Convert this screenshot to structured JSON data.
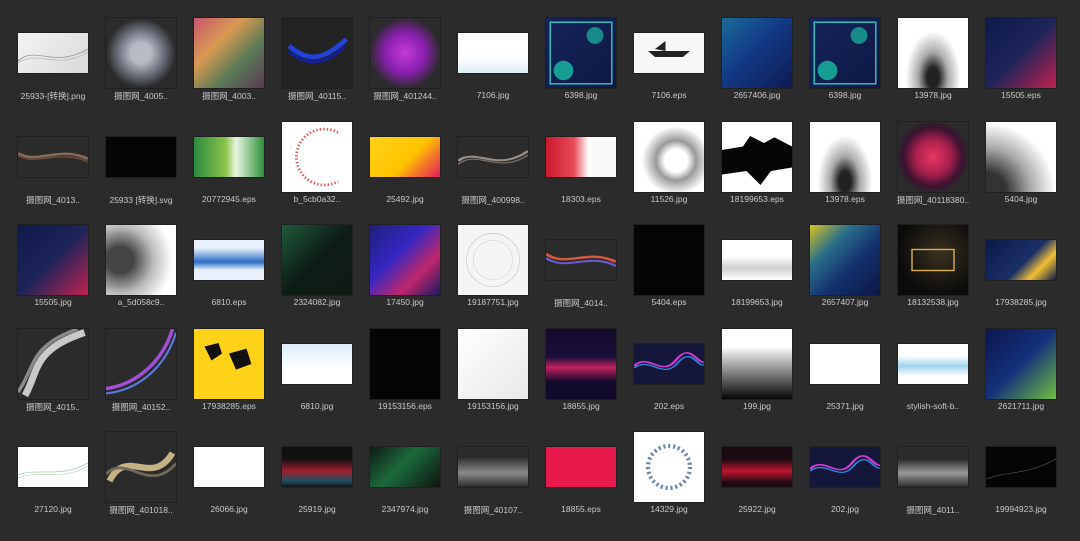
{
  "files": [
    {
      "name": "25933-[转换].png",
      "thumb": "wave-light",
      "shape": "wide"
    },
    {
      "name": "摄图网_4005..",
      "thumb": "halftone-dark",
      "shape": "square"
    },
    {
      "name": "摄图网_4003..",
      "thumb": "checker-colorful",
      "shape": "square"
    },
    {
      "name": "摄图网_40115..",
      "thumb": "blue-swirl-dark",
      "shape": "square"
    },
    {
      "name": "摄图网_401244..",
      "thumb": "purple-glow",
      "shape": "square"
    },
    {
      "name": "7106.jpg",
      "thumb": "white-card",
      "shape": "wide"
    },
    {
      "name": "6398.jpg",
      "thumb": "sample-text-navy",
      "shape": "square"
    },
    {
      "name": "7106.eps",
      "thumb": "white-boat",
      "shape": "wide"
    },
    {
      "name": "2657406.jpg",
      "thumb": "navy-gradient",
      "shape": "square"
    },
    {
      "name": "6398.jpg",
      "thumb": "sample-text-navy",
      "shape": "square"
    },
    {
      "name": "13978.jpg",
      "thumb": "halftone-white",
      "shape": "square"
    },
    {
      "name": "15505.eps",
      "thumb": "navy-pink-dots",
      "shape": "square"
    },
    {
      "name": "摄图网_4013..",
      "thumb": "brown-wave-dark",
      "shape": "wide"
    },
    {
      "name": "25933 [转换].svg",
      "thumb": "black",
      "shape": "wide"
    },
    {
      "name": "20772945.eps",
      "thumb": "green-watercolor",
      "shape": "wide"
    },
    {
      "name": "b_5cb0a32..",
      "thumb": "red-dot-arc",
      "shape": "square"
    },
    {
      "name": "25492.jpg",
      "thumb": "yellow-card",
      "shape": "wide"
    },
    {
      "name": "摄图网_400998..",
      "thumb": "gray-wave-dark",
      "shape": "wide"
    },
    {
      "name": "18303.eps",
      "thumb": "red-white-card",
      "shape": "wide"
    },
    {
      "name": "11526.jpg",
      "thumb": "halftone-circle-white",
      "shape": "square"
    },
    {
      "name": "18199653.eps",
      "thumb": "black-splash",
      "shape": "square"
    },
    {
      "name": "13978.eps",
      "thumb": "halftone-white",
      "shape": "square"
    },
    {
      "name": "摄图网_40118380..",
      "thumb": "pink-glow",
      "shape": "square"
    },
    {
      "name": "5404.jpg",
      "thumb": "halftone-corner",
      "shape": "square"
    },
    {
      "name": "15505.jpg",
      "thumb": "navy-pink-dots",
      "shape": "square"
    },
    {
      "name": "a_5d058c9..",
      "thumb": "halftone-gray",
      "shape": "square"
    },
    {
      "name": "6810.eps",
      "thumb": "blue-watercolor",
      "shape": "wide"
    },
    {
      "name": "2324082.jpg",
      "thumb": "dark-green-gradient",
      "shape": "square"
    },
    {
      "name": "17450.jpg",
      "thumb": "blue-purple-wave",
      "shape": "square"
    },
    {
      "name": "19187751.jpg",
      "thumb": "white-circles",
      "shape": "square"
    },
    {
      "name": "摄图网_4014..",
      "thumb": "colorful-ribbon-dark",
      "shape": "wide"
    },
    {
      "name": "5404.eps",
      "thumb": "black",
      "shape": "square"
    },
    {
      "name": "18199653.jpg",
      "thumb": "white-gray-wave",
      "shape": "wide"
    },
    {
      "name": "2657407.jpg",
      "thumb": "navy-yellow-dots",
      "shape": "square"
    },
    {
      "name": "18132538.jpg",
      "thumb": "black-gold",
      "shape": "square"
    },
    {
      "name": "17938285.jpg",
      "thumb": "navy-gold-card",
      "shape": "wide"
    },
    {
      "name": "摄图网_4015..",
      "thumb": "gray-ribbon",
      "shape": "square"
    },
    {
      "name": "摄图网_40152..",
      "thumb": "purple-arc-dark",
      "shape": "square"
    },
    {
      "name": "17938285.eps",
      "thumb": "yellow-splash",
      "shape": "square"
    },
    {
      "name": "6810.jpg",
      "thumb": "light-blue-card",
      "shape": "wide"
    },
    {
      "name": "19153156.eps",
      "thumb": "black",
      "shape": "square"
    },
    {
      "name": "19153156.jpg",
      "thumb": "white-soft",
      "shape": "square"
    },
    {
      "name": "18855.jpg",
      "thumb": "dark-pink-lines",
      "shape": "square"
    },
    {
      "name": "202.eps",
      "thumb": "neon-wave-dark",
      "shape": "wide"
    },
    {
      "name": "199.jpg",
      "thumb": "white-black-gradient",
      "shape": "square"
    },
    {
      "name": "25371.jpg",
      "thumb": "white-plain",
      "shape": "wide"
    },
    {
      "name": "stylish-soft-b..",
      "thumb": "blue-wave-white",
      "shape": "wide"
    },
    {
      "name": "2621711.jpg",
      "thumb": "navy-green-dots",
      "shape": "square"
    },
    {
      "name": "27120.jpg",
      "thumb": "green-lines-white",
      "shape": "wide"
    },
    {
      "name": "摄图网_401018..",
      "thumb": "gold-ribbon-dark",
      "shape": "square"
    },
    {
      "name": "26066.jpg",
      "thumb": "white-plain",
      "shape": "wide"
    },
    {
      "name": "25919.jpg",
      "thumb": "dark-red-glow",
      "shape": "wide"
    },
    {
      "name": "2347974.jpg",
      "thumb": "dark-green-lines",
      "shape": "wide"
    },
    {
      "name": "摄图网_40107..",
      "thumb": "gray-mesh-dark",
      "shape": "wide"
    },
    {
      "name": "18855.eps",
      "thumb": "pink-plain",
      "shape": "wide"
    },
    {
      "name": "14329.jpg",
      "thumb": "blue-splash-white",
      "shape": "square"
    },
    {
      "name": "25922.jpg",
      "thumb": "red-wave-dark",
      "shape": "wide"
    },
    {
      "name": "202.jpg",
      "thumb": "neon-wave-dark",
      "shape": "wide"
    },
    {
      "name": "摄图网_4011..",
      "thumb": "white-mesh-dark",
      "shape": "wide"
    },
    {
      "name": "19994923.jpg",
      "thumb": "black-line",
      "shape": "wide"
    }
  ]
}
